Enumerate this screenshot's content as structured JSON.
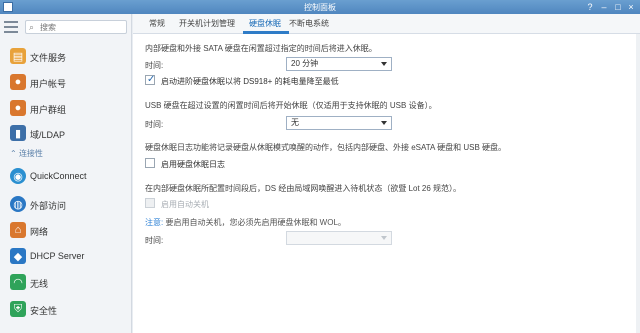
{
  "window": {
    "title": "控制面板"
  },
  "search": {
    "placeholder": "搜索"
  },
  "sidebar": {
    "items": [
      {
        "label": "文件服务",
        "icon": "folder-icon"
      },
      {
        "label": "用户帐号",
        "icon": "user-icon"
      },
      {
        "label": "用户群组",
        "icon": "group-icon"
      },
      {
        "label": "域/LDAP",
        "icon": "domain-icon"
      },
      {
        "label": "QuickConnect",
        "icon": "quickconnect-icon"
      },
      {
        "label": "外部访问",
        "icon": "globe-icon"
      },
      {
        "label": "网络",
        "icon": "network-icon"
      },
      {
        "label": "DHCP Server",
        "icon": "dhcp-icon"
      },
      {
        "label": "无线",
        "icon": "wifi-icon"
      },
      {
        "label": "安全性",
        "icon": "shield-icon"
      }
    ],
    "section_connectivity": "连接性"
  },
  "tabs": [
    "常规",
    "开关机计划管理",
    "硬盘休眠",
    "不断电系统"
  ],
  "active_tab": "硬盘休眠",
  "hibernation": {
    "internal_desc": "内部硬盘和外接 SATA 硬盘在闲置超过指定的时间后将进入休眠。",
    "time_label": "时间:",
    "internal_time": "20 分钟",
    "advanced_label": "启动进阶硬盘休眠以将 DS918+ 的耗电量降至最低",
    "usb_desc": "USB 硬盘在超过设置的闲置时间后将开始休眠（仅适用于支持休眠的 USB 设备）。",
    "usb_time": "无",
    "log_desc": "硬盘休眠日志功能将记录硬盘从休眠模式唤醒的动作，包括内部硬盘、外接 eSATA 硬盘和 USB 硬盘。",
    "log_label": "启用硬盘休眠日志",
    "standby_desc": "在内部硬盘休眠所配置时间段后，DS 经由局域网唤醒进入待机状态（欲暨 Lot 26 规范）。",
    "auto_poweroff_label": "启用自动关机",
    "note_prefix": "注意:",
    "note_text": " 要启用自动关机，您必须先启用硬盘休眠和 WOL。",
    "poweroff_time": ""
  }
}
